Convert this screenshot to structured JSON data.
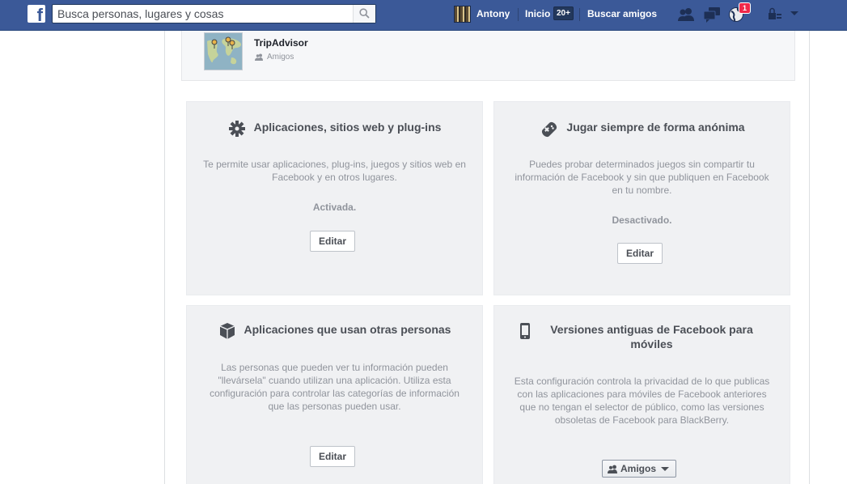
{
  "topbar": {
    "logo_letter": "f",
    "search_placeholder": "Busca personas, lugares y cosas",
    "user_name": "Antony",
    "home_label": "Inicio",
    "home_count": "20+",
    "find_friends_label": "Buscar amigos",
    "notification_count": "1",
    "bar_color": "#3b5998"
  },
  "app_entry": {
    "title": "TripAdvisor",
    "audience": "Amigos"
  },
  "cards": [
    {
      "title": "Aplicaciones, sitios web y plug-ins",
      "description": "Te permite usar aplicaciones, plug-ins, juegos y sitios web en Facebook y en otros lugares.",
      "status": "Activada.",
      "button": "Editar",
      "icon": "gear-icon"
    },
    {
      "title": "Jugar siempre de forma anónima",
      "description": "Puedes probar determinados juegos sin compartir tu información de Facebook y sin que publiquen en Facebook en tu nombre.",
      "status": "Desactivado.",
      "button": "Editar",
      "icon": "gamepad-icon"
    },
    {
      "title": "Aplicaciones que usan otras personas",
      "description": "Las personas que pueden ver tu información pueden \"llevársela\" cuando utilizan una aplicación. Utiliza esta configuración para controlar las categorías de información que las personas pueden usar.",
      "button": "Editar",
      "icon": "cube-icon"
    },
    {
      "title": "Versiones antiguas de Facebook para móviles",
      "description": "Esta configuración controla la privacidad de lo que publicas con las aplicaciones para móviles de Facebook anteriores que no tengan el selector de público, como las versiones obsoletas de Facebook para BlackBerry.",
      "audience_button": "Amigos",
      "icon": "mobile-phone-icon"
    }
  ]
}
